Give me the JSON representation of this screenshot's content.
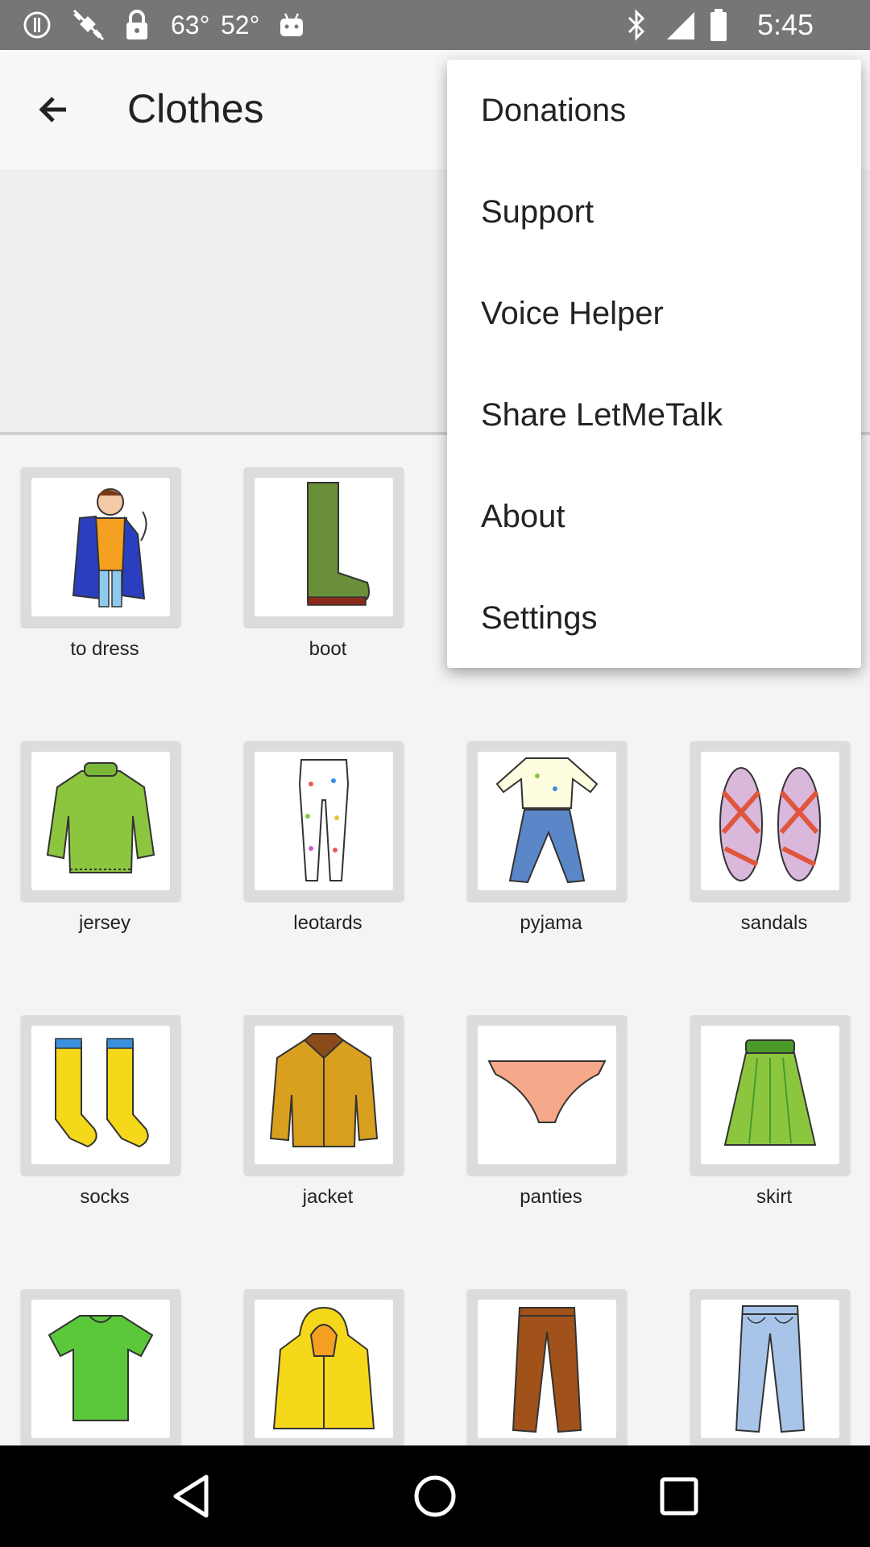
{
  "status_bar": {
    "temp_high": "63°",
    "temp_low": "52°",
    "time": "5:45",
    "icons": [
      "alert-circle-icon",
      "satellite-off-icon",
      "lock-icon",
      "android-icon",
      "bluetooth-icon",
      "signal-icon",
      "battery-icon"
    ]
  },
  "app_bar": {
    "back_icon": "arrow-back-icon",
    "title": "Clothes"
  },
  "menu": {
    "items": [
      "Donations",
      "Support",
      "Voice Helper",
      "Share LetMeTalk",
      "About",
      "Settings"
    ]
  },
  "grid": {
    "items": [
      {
        "label": "to dress",
        "icon": "to-dress-icon"
      },
      {
        "label": "boot",
        "icon": "boot-icon"
      },
      {
        "label": "jersey",
        "icon": "jersey-icon"
      },
      {
        "label": "leotards",
        "icon": "leotards-icon"
      },
      {
        "label": "pyjama",
        "icon": "pyjama-icon"
      },
      {
        "label": "sandals",
        "icon": "sandals-icon"
      },
      {
        "label": "socks",
        "icon": "socks-icon"
      },
      {
        "label": "jacket",
        "icon": "jacket-icon"
      },
      {
        "label": "panties",
        "icon": "panties-icon"
      },
      {
        "label": "skirt",
        "icon": "skirt-icon"
      },
      {
        "label": "",
        "icon": "t-shirt-icon"
      },
      {
        "label": "",
        "icon": "raincoat-icon"
      },
      {
        "label": "",
        "icon": "trousers-icon"
      },
      {
        "label": "",
        "icon": "jeans-icon"
      }
    ]
  },
  "nav_bar": {
    "icons": [
      "back-triangle-icon",
      "home-circle-icon",
      "recents-square-icon"
    ]
  },
  "colors": {
    "status_bar": "#767676",
    "app_bar": "#f7f7f7",
    "background": "#efefef",
    "nav_bar": "#000000"
  }
}
